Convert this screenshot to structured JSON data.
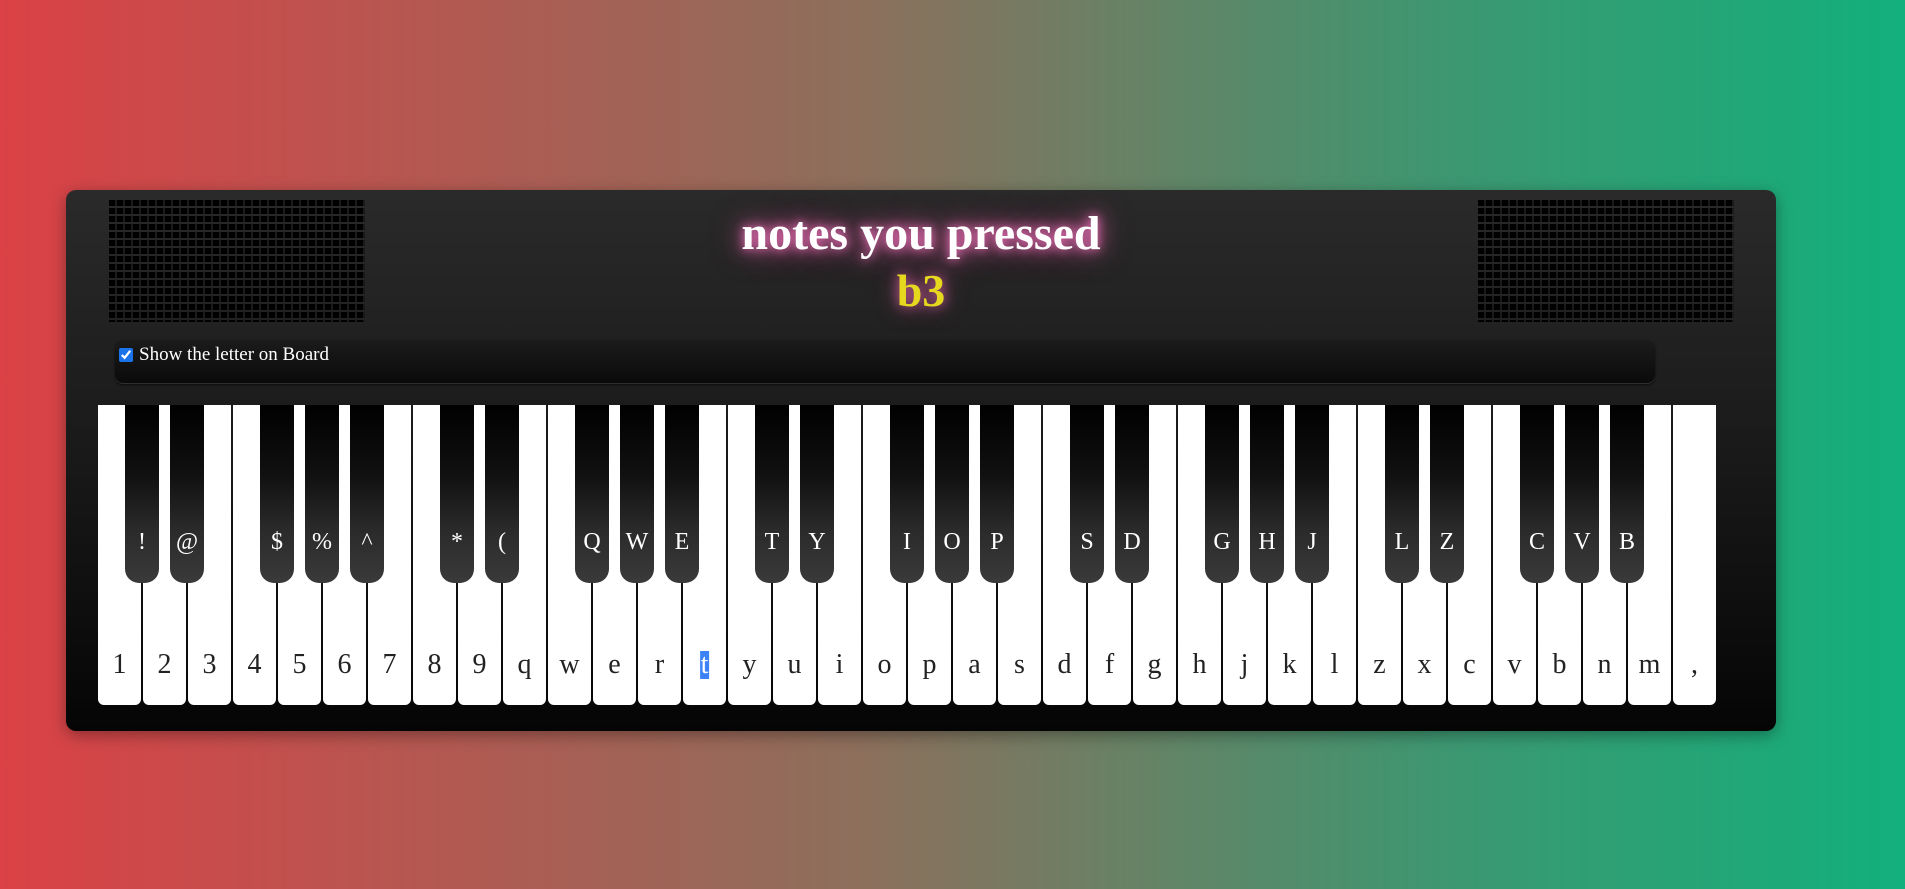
{
  "display": {
    "title": "notes you pressed",
    "current_note": "b3"
  },
  "options": {
    "show_letters_label": "Show the letter on Board",
    "show_letters_checked": true
  },
  "white_keys": [
    "1",
    "2",
    "3",
    "4",
    "5",
    "6",
    "7",
    "8",
    "9",
    "q",
    "w",
    "e",
    "r",
    "t",
    "y",
    "u",
    "i",
    "o",
    "p",
    "a",
    "s",
    "d",
    "f",
    "g",
    "h",
    "j",
    "k",
    "l",
    "z",
    "x",
    "c",
    "v",
    "b",
    "n",
    "m",
    ","
  ],
  "selected_white_key": "t",
  "black_keys": [
    "!",
    "@",
    "$",
    "%",
    "^",
    "*",
    "(",
    "Q",
    "W",
    "E",
    "T",
    "Y",
    "I",
    "O",
    "P",
    "S",
    "D",
    "G",
    "H",
    "J",
    "L",
    "Z",
    "C",
    "V",
    "B"
  ],
  "colors": {
    "note_text": "#e6d81e",
    "title_glow": "#ff7ac8",
    "selection": "#3b82f6"
  }
}
